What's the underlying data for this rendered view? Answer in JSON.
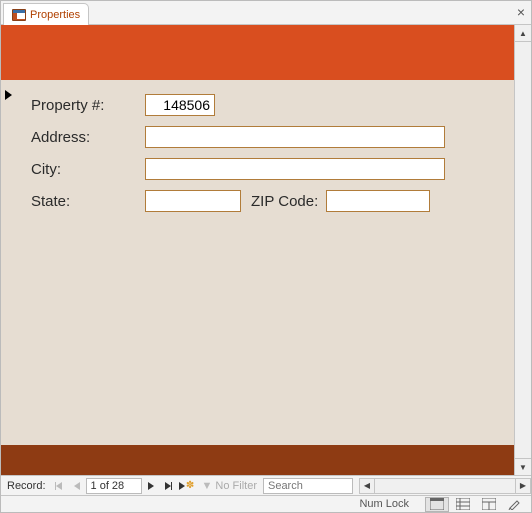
{
  "tab": {
    "title": "Properties"
  },
  "header": {},
  "form": {
    "labels": {
      "property_num": "Property #:",
      "address": "Address:",
      "city": "City:",
      "state": "State:",
      "zip": "ZIP Code:"
    },
    "values": {
      "property_num": "148506",
      "address": "",
      "city": "",
      "state": "",
      "zip": ""
    }
  },
  "recordnav": {
    "label": "Record:",
    "position": "1 of 28",
    "filter_label": "No Filter",
    "search_placeholder": "Search"
  },
  "status": {
    "numlock": "Num Lock"
  }
}
